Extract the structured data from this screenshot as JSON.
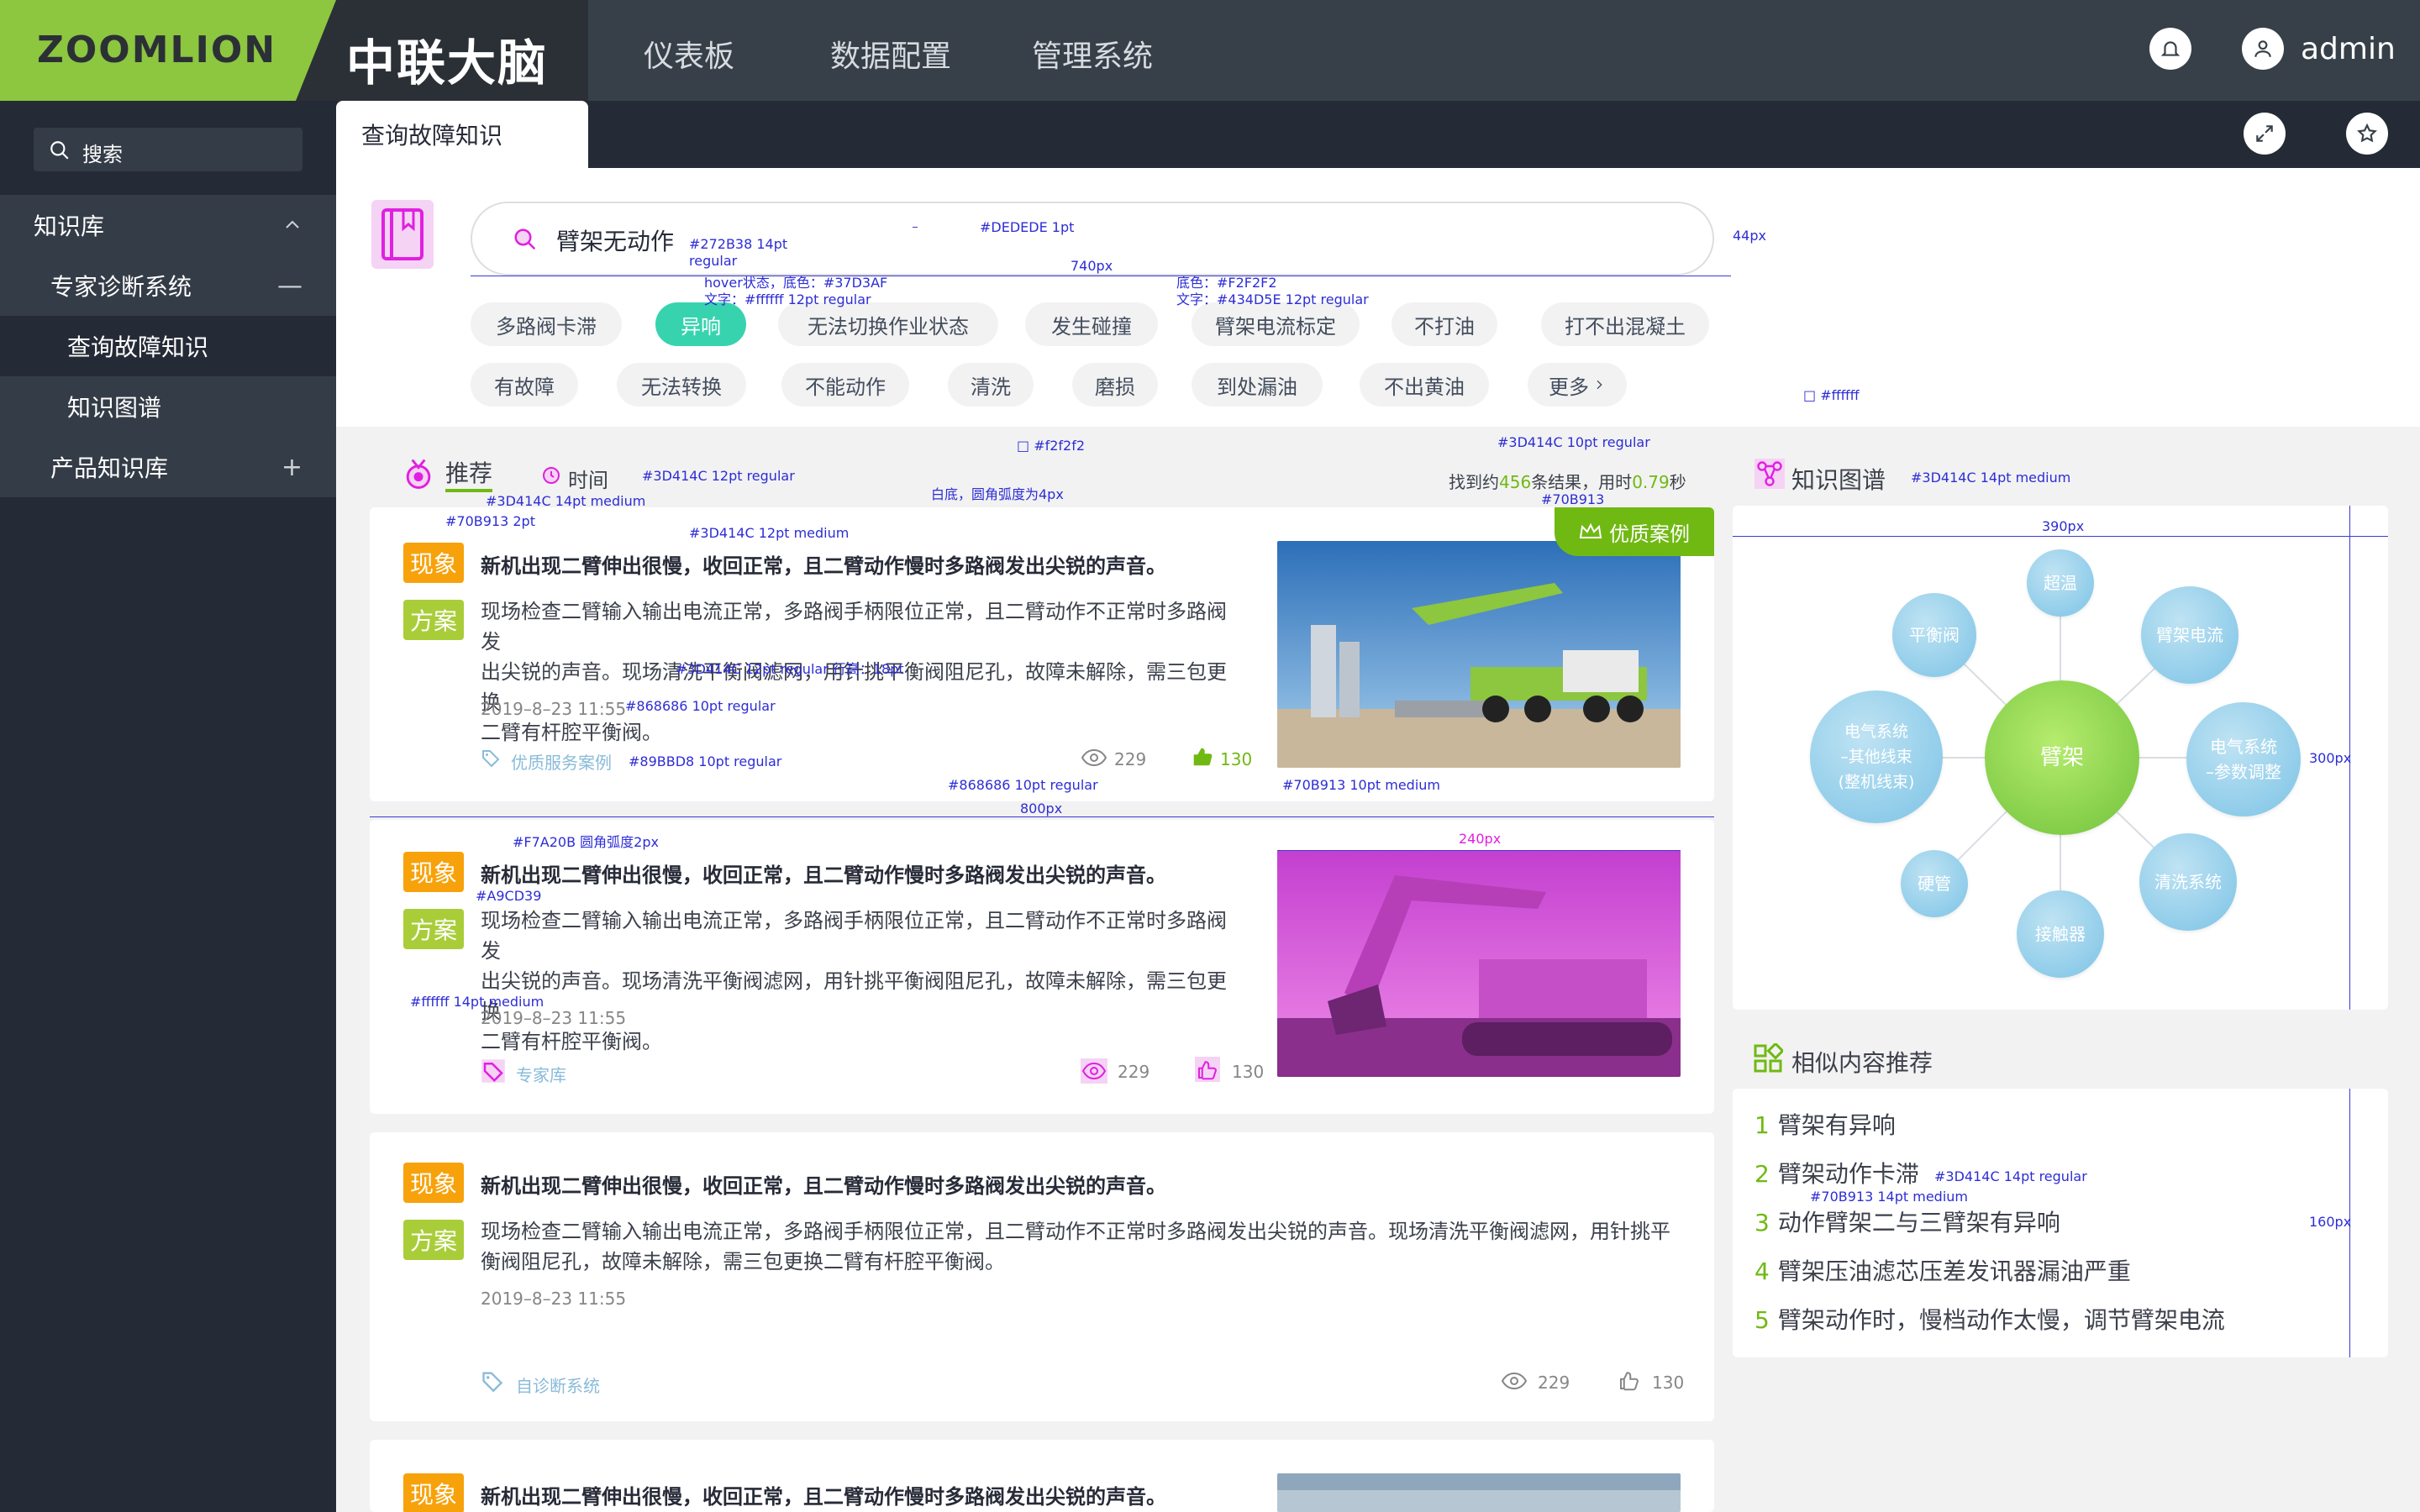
{
  "header": {
    "logo": "ZOOMLION",
    "brand": "中联大脑",
    "nav": [
      "仪表板",
      "数据配置",
      "管理系统"
    ],
    "username": "admin"
  },
  "sidebar": {
    "search_placeholder": "搜索",
    "items": [
      {
        "label": "知识库",
        "toggle": "⌃"
      },
      {
        "label": "专家诊断系统",
        "toggle": "—"
      },
      {
        "label": "查询故障知识"
      },
      {
        "label": "知识图谱"
      },
      {
        "label": "产品知识库",
        "toggle": "+"
      }
    ]
  },
  "tabs": {
    "active": "查询故障知识"
  },
  "search": {
    "query": "臂架无动作",
    "chips_row1": [
      "多路阀卡滞",
      "异响",
      "无法切换作业状态",
      "发生碰撞",
      "臂架电流标定",
      "不打油",
      "打不出混凝土"
    ],
    "chips_row2": [
      "有故障",
      "无法转换",
      "不能动作",
      "清洗",
      "磨损",
      "到处漏油",
      "不出黄油",
      "更多"
    ],
    "active_chip": "异响"
  },
  "recommend": {
    "title": "推荐",
    "sort_label": "时间",
    "result_prefix": "找到约",
    "result_count": "456",
    "result_mid": "条结果，用时",
    "result_time": "0.79",
    "result_suffix": "秒"
  },
  "cards": [
    {
      "phenomenon_badge": "现象",
      "solution_badge": "方案",
      "title": "新机出现二臂伸出很慢，收回正常，且二臂动作慢时多路阀发出尖锐的声音。",
      "body_lines": [
        "现场检查二臂输入输出电流正常，多路阀手柄限位正常，且二臂动作不正常时多路阀发",
        "出尖锐的声音。现场清洗平衡阀滤网，用针挑平衡阀阻尼孔，故障未解除，需三包更换",
        "二臂有杆腔平衡阀。"
      ],
      "date": "2019–8–23 11:55",
      "source": "优质服务案例",
      "views": "229",
      "likes": "130",
      "ribbon": "优质案例"
    },
    {
      "phenomenon_badge": "现象",
      "solution_badge": "方案",
      "title": "新机出现二臂伸出很慢，收回正常，且二臂动作慢时多路阀发出尖锐的声音。",
      "body_lines": [
        "现场检查二臂输入输出电流正常，多路阀手柄限位正常，且二臂动作不正常时多路阀发",
        "出尖锐的声音。现场清洗平衡阀滤网，用针挑平衡阀阻尼孔，故障未解除，需三包更换",
        "二臂有杆腔平衡阀。"
      ],
      "date": "2019–8–23 11:55",
      "source": "专家库",
      "views": "229",
      "likes": "130"
    },
    {
      "phenomenon_badge": "现象",
      "solution_badge": "方案",
      "title": "新机出现二臂伸出很慢，收回正常，且二臂动作慢时多路阀发出尖锐的声音。",
      "body_lines": [
        "现场检查二臂输入输出电流正常，多路阀手柄限位正常，且二臂动作不正常时多路阀发出尖锐的声音。现场清洗平衡阀滤网，用针挑平",
        "衡阀阻尼孔，故障未解除，需三包更换二臂有杆腔平衡阀。"
      ],
      "date": "2019–8–23 11:55",
      "source": "自诊断系统",
      "views": "229",
      "likes": "130"
    },
    {
      "phenomenon_badge": "现象",
      "title": "新机出现二臂伸出很慢，收回正常，且二臂动作慢时多路阀发出尖锐的声音。"
    }
  ],
  "knowledge_graph": {
    "title": "知识图谱",
    "center": "臂架",
    "nodes": [
      "超温",
      "臂架电流",
      "电气系统\n–参数调整",
      "清洗系统",
      "接触器",
      "硬管",
      "电气系统\n–其他线束\n(整机线束)",
      "平衡阀"
    ]
  },
  "similar": {
    "title": "相似内容推荐",
    "items": [
      {
        "n": "1",
        "text": "臂架有异响"
      },
      {
        "n": "2",
        "text": "臂架动作卡滞"
      },
      {
        "n": "3",
        "text": "动作臂架二与三臂架有异响"
      },
      {
        "n": "4",
        "text": "臂架压油滤芯压差发讯器漏油严重"
      },
      {
        "n": "5",
        "text": "臂架动作时，慢档动作太慢，调节臂架电流"
      }
    ]
  },
  "annotations": {
    "a1": "#DEDEDE 1pt",
    "a2": "#272B38 14pt",
    "a2b": "regular",
    "a3": "hover状态，底色：#37D3AF",
    "a4": "文字：#ffffff 12pt regular",
    "a5": "底色：#F2F2F2",
    "a6": "文字：#434D5E 12pt regular",
    "a7": "740px",
    "a8": "#3D414C 10pt regular",
    "a9": "#70B913",
    "a10": "#3D414C 12pt regular",
    "a11": "#3D414C 14pt medium",
    "a12": "#70B913 2pt",
    "a13": "白底，圆角弧度为4px",
    "a14": "#3D414C 12pt medium",
    "a15": "#3D414C 14pt medium",
    "a16": "#3D414C 12pt regular  行高：18pt",
    "a17": "#868686 10pt regular",
    "a18": "#89BBD8 10pt regular",
    "a19": "#868686 10pt regular",
    "a20": "#70B913 10pt medium",
    "a21": "800px",
    "a22": "#F7A20B  圆角弧度2px",
    "a23": "#A9CD39",
    "a24": "#ffffff 14pt medium",
    "a25": "240px",
    "a26": "390px",
    "a27": "300px",
    "a28": "#3D414C 14pt regular",
    "a29": "#70B913 14pt medium",
    "a30": "160px",
    "a31": "□ #ffffff",
    "a32": "□ #f2f2f2",
    "a33": "44px"
  },
  "colors": {
    "accent_green": "#70B913",
    "chip_hover": "#37D3AF",
    "badge_orange": "#F7A20B",
    "badge_green": "#A9CD39",
    "topbar": "#374049",
    "sidebar": "#252b36",
    "logo_bg": "#8dc63f"
  },
  "icons": {
    "notification": "bell-icon",
    "user": "user-icon",
    "search": "search-icon",
    "fullscreen": "expand-icon",
    "favorite": "star-icon",
    "book": "book-icon",
    "medal": "medal-icon",
    "clock": "clock-icon",
    "eye": "eye-icon",
    "like": "thumbs-up-icon",
    "tag": "tag-icon",
    "crown": "crown-icon",
    "graph": "graph-icon",
    "similar": "grid-icon"
  }
}
